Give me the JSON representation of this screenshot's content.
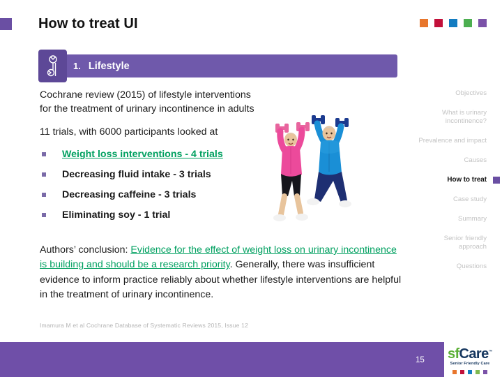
{
  "slide": {
    "title": "How to treat UI",
    "page_number": "15"
  },
  "accent_swatches": [
    {
      "name": "orange",
      "color": "#e8762c"
    },
    {
      "name": "crimson",
      "color": "#c2103a"
    },
    {
      "name": "blue",
      "color": "#137cc1"
    },
    {
      "name": "green",
      "color": "#4caf50"
    },
    {
      "name": "purple",
      "color": "#7b52a8"
    }
  ],
  "banner": {
    "icon": "wrench-icon",
    "number": "1.",
    "label": "Lifestyle",
    "color": "#6f59ab"
  },
  "body": {
    "intro": "Cochrane review (2015) of lifestyle interventions for the treatment of urinary incontinence in adults",
    "trials_line": "11 trials, with 6000 participants looked at",
    "bullets": [
      {
        "text": "Weight loss interventions - 4 trials",
        "highlight": true
      },
      {
        "text": "Decreasing fluid intake - 3 trials",
        "highlight": false
      },
      {
        "text": "Decreasing caffeine - 3 trials",
        "highlight": false
      },
      {
        "text": "Eliminating soy - 1 trial",
        "highlight": false
      }
    ],
    "conclusion": {
      "lead": "Authors’ conclusion: ",
      "highlighted": "Evidence for the effect of weight loss on urinary incontinence is building and should be a research priority",
      "rest": ". Generally, there was insufficient evidence to inform practice reliably about whether lifestyle interventions are helpful in the treatment of urinary incontinence."
    },
    "citation": "Imamura M et al Cochrane Database of Systematic Reviews 2015, Issue 12"
  },
  "photo": {
    "alt": "Two older adults exercising with dumbbells, arms raised",
    "woman_jacket": "#ec4a9b",
    "woman_pants": "#16161c",
    "man_jacket": "#1a8fd6",
    "man_pants": "#1e2f72"
  },
  "nav": {
    "items": [
      {
        "label": "Objectives",
        "active": false
      },
      {
        "label": "What is urinary incontinence?",
        "active": false
      },
      {
        "label": "Prevalence and impact",
        "active": false
      },
      {
        "label": "Causes",
        "active": false
      },
      {
        "label": "How to treat",
        "active": true
      },
      {
        "label": "Case study",
        "active": false
      },
      {
        "label": "Summary",
        "active": false
      },
      {
        "label": "Senior friendly approach",
        "active": false
      },
      {
        "label": "Questions",
        "active": false
      }
    ],
    "marker_color": "#6a4fa3"
  },
  "logo": {
    "prefix": "sf",
    "name": "Care",
    "trademark": "™",
    "tagline": "Senior Friendly Care",
    "dots": [
      "#e8762c",
      "#c2103a",
      "#137cc1",
      "#7fb950",
      "#7b52a8"
    ]
  },
  "footer": {
    "color": "#6f4fa8"
  }
}
